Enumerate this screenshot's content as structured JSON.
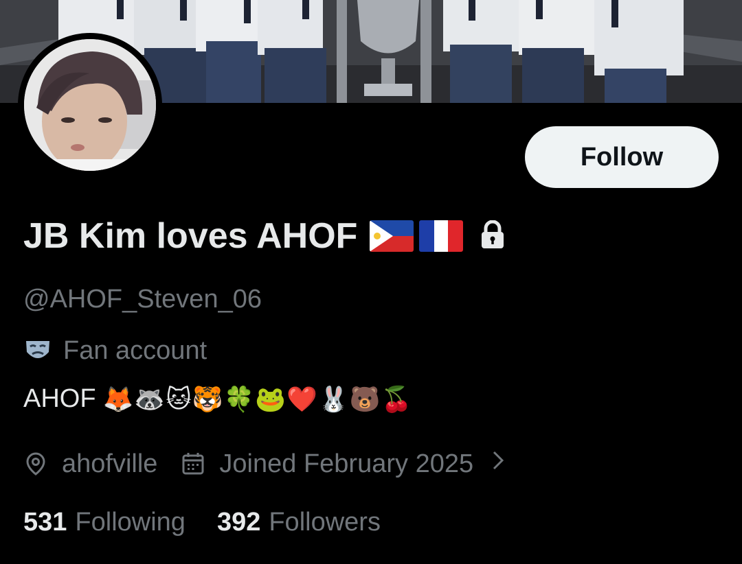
{
  "profile": {
    "display_name": "JB Kim loves AHOF",
    "flags": [
      "philippines-flag",
      "france-flag"
    ],
    "protected_icon": "lock-icon",
    "handle": "@AHOF_Steven_06",
    "label": {
      "icon": "theater-mask-icon",
      "text": "Fan account"
    },
    "bio": {
      "text": "AHOF",
      "emojis": "🦊🦝🐱🐯🍀🐸❤️🐰🐻🍒"
    },
    "location": {
      "icon": "location-pin-icon",
      "text": "ahofville"
    },
    "joined": {
      "icon": "calendar-icon",
      "text": "Joined February 2025"
    },
    "stats": {
      "following_count": "531",
      "following_label": "Following",
      "followers_count": "392",
      "followers_label": "Followers"
    }
  },
  "actions": {
    "follow_label": "Follow"
  },
  "colors": {
    "background": "#000000",
    "primary_text": "#e7e9ea",
    "secondary_text": "#71767b",
    "button_bg": "#eff3f4"
  }
}
